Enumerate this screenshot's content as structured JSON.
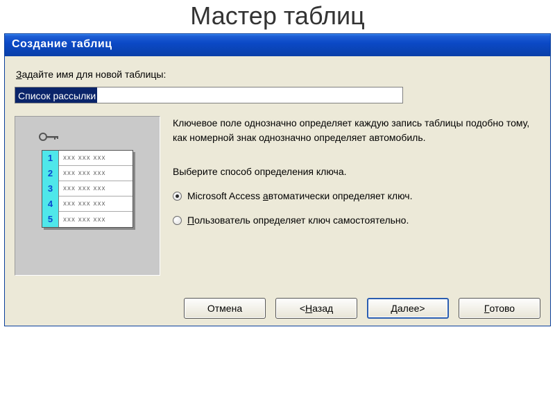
{
  "page": {
    "heading": "Мастер таблиц"
  },
  "window": {
    "title": "Создание таблиц"
  },
  "prompt": {
    "label_pre": "З",
    "label_rest": "адайте имя для новой таблицы:"
  },
  "input": {
    "value": "Список рассылки"
  },
  "description": {
    "text": "Ключевое поле однозначно определяет каждую запись таблицы подобно тому, как номерной знак однозначно определяет автомобиль."
  },
  "sub_prompt": {
    "text": "Выберите способ определения ключа."
  },
  "radios": {
    "auto_pre": "Microsoft Access ",
    "auto_u": "а",
    "auto_rest": "втоматически определяет ключ.",
    "user_u": "П",
    "user_rest": "ользователь определяет ключ самостоятельно.",
    "selected": "auto"
  },
  "illustration": {
    "rows": [
      {
        "n": "1",
        "d": "xxx xxx xxx"
      },
      {
        "n": "2",
        "d": "xxx xxx xxx"
      },
      {
        "n": "3",
        "d": "xxx xxx xxx"
      },
      {
        "n": "4",
        "d": "xxx xxx xxx"
      },
      {
        "n": "5",
        "d": "xxx xxx xxx"
      }
    ]
  },
  "buttons": {
    "cancel": "Отмена",
    "back_lt": "< ",
    "back_u": "Н",
    "back_rest": "азад",
    "next_u": "Д",
    "next_rest": "алее ",
    "next_gt": ">",
    "finish_u": "Г",
    "finish_rest": "отово"
  }
}
